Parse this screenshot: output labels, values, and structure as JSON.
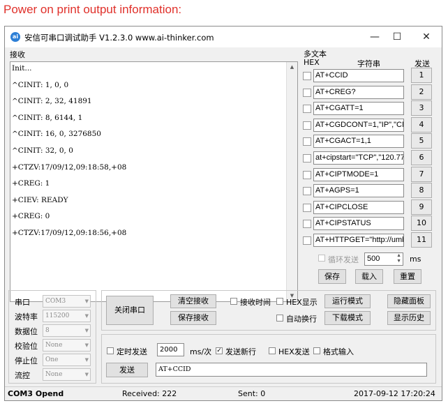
{
  "caption": "Power on print output information:",
  "window": {
    "title": "安信可串口调试助手 V1.2.3.0   www.ai-thinker.com",
    "minimize": "—",
    "maximize": "☐",
    "close": "✕"
  },
  "receive": {
    "label": "接收",
    "lines": [
      "Init...",
      "^CINIT: 1, 0, 0",
      "^CINIT: 2, 32, 41891",
      "^CINIT: 8, 6144, 1",
      "^CINIT: 16, 0, 3276850",
      "^CINIT: 32, 0, 0",
      "+CTZV:17/09/12,09:18:58,+08",
      "+CREG: 1",
      "+CIEV: READY",
      "+CREG: 0",
      "+CTZV:17/09/12,09:18:56,+08"
    ]
  },
  "multi": {
    "title": "多文本",
    "hex_header": "HEX",
    "string_header": "字符串",
    "send_header": "发送",
    "rows": [
      {
        "text": "AT+CCID",
        "n": "1"
      },
      {
        "text": "AT+CREG?",
        "n": "2"
      },
      {
        "text": "AT+CGATT=1",
        "n": "3"
      },
      {
        "text": "AT+CGDCONT=1,\"IP\",\"CM",
        "n": "4"
      },
      {
        "text": "AT+CGACT=1,1",
        "n": "5"
      },
      {
        "text": "at+cipstart=\"TCP\",\"120.77.",
        "n": "6"
      },
      {
        "text": "AT+CIPTMODE=1",
        "n": "7"
      },
      {
        "text": "AT+AGPS=1",
        "n": "8"
      },
      {
        "text": "AT+CIPCLOSE",
        "n": "9"
      },
      {
        "text": "AT+CIPSTATUS",
        "n": "10"
      },
      {
        "text": "AT+HTTPGET=\"http://umb",
        "n": "11"
      }
    ],
    "loop_label": "循环发送",
    "loop_value": "500",
    "ms": "ms",
    "save": "保存",
    "load": "载入",
    "reset": "重置"
  },
  "serial": {
    "port_label": "串口",
    "port": "COM3",
    "baud_label": "波特率",
    "baud": "115200",
    "data_label": "数据位",
    "data": "8",
    "parity_label": "校验位",
    "parity": "None",
    "stop_label": "停止位",
    "stop": "One",
    "flow_label": "流控",
    "flow": "None"
  },
  "controls": {
    "close_port": "关闭串口",
    "clear_recv": "清空接收",
    "save_recv": "保存接收",
    "recv_time": "接收时间",
    "hex_display": "HEX显示",
    "auto_wrap": "自动换行",
    "run_mode": "运行模式",
    "download_mode": "下载模式",
    "hide_panel": "隐藏面板",
    "show_history": "显示历史"
  },
  "send": {
    "timed_send": "定时发送",
    "interval": "2000",
    "interval_unit": "ms/次",
    "newline": "发送新行",
    "hex_send": "HEX发送",
    "format_input": "格式输入",
    "send_button": "发送",
    "text": "AT+CCID"
  },
  "status": {
    "port": "COM3 Opend",
    "received": "Received: 222",
    "sent": "Sent: 0",
    "datetime": "2017-09-12 17:20:24"
  }
}
